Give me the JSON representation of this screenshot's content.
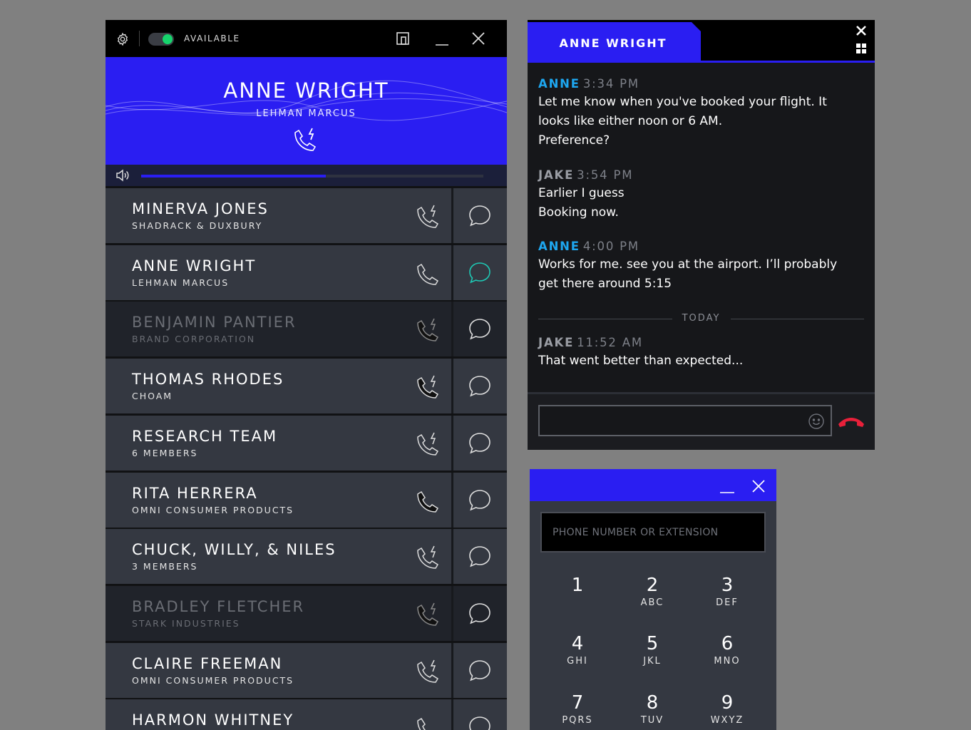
{
  "contacts_window": {
    "status": {
      "label": "AVAILABLE",
      "available": true,
      "indicator_color": "#16d46c"
    },
    "icons": {
      "settings": "gear-icon",
      "popout": "popout-icon",
      "minimize": "minimize-icon",
      "close": "close-icon"
    },
    "active_call": {
      "name": "ANNE WRIGHT",
      "company": "LEHMAN MARCUS",
      "icon": "phone-active-icon",
      "volume_level": 0.54
    },
    "contacts": [
      {
        "name": "MINERVA JONES",
        "subtitle": "SHADRACK & DUXBURY",
        "call_icon": "phone-callback-icon",
        "dimmed": false,
        "chat_active": false
      },
      {
        "name": "ANNE WRIGHT",
        "subtitle": "LEHMAN MARCUS",
        "call_icon": "phone-icon",
        "dimmed": false,
        "chat_active": true
      },
      {
        "name": "BENJAMIN PANTIER",
        "subtitle": "BRAND CORPORATION",
        "call_icon": "phone-busy-icon",
        "dimmed": true,
        "chat_active": false
      },
      {
        "name": "THOMAS RHODES",
        "subtitle": "CHOAM",
        "call_icon": "phone-busy-icon",
        "dimmed": false,
        "chat_active": false
      },
      {
        "name": "RESEARCH TEAM",
        "subtitle": "6 MEMBERS",
        "call_icon": "phone-callback-icon",
        "dimmed": false,
        "chat_active": false
      },
      {
        "name": "RITA HERRERA",
        "subtitle": "OMNI CONSUMER PRODUCTS",
        "call_icon": "phone-filled-icon",
        "dimmed": false,
        "chat_active": false
      },
      {
        "name": "CHUCK, WILLY, & NILES",
        "subtitle": "3 MEMBERS",
        "call_icon": "phone-callback-icon",
        "dimmed": false,
        "chat_active": false
      },
      {
        "name": "BRADLEY FLETCHER",
        "subtitle": "STARK INDUSTRIES",
        "call_icon": "phone-busy-icon",
        "dimmed": true,
        "chat_active": false
      },
      {
        "name": "CLAIRE FREEMAN",
        "subtitle": "OMNI CONSUMER PRODUCTS",
        "call_icon": "phone-callback-icon",
        "dimmed": false,
        "chat_active": false
      },
      {
        "name": "HARMON WHITNEY",
        "subtitle": "",
        "call_icon": "phone-icon",
        "dimmed": false,
        "chat_active": false
      }
    ]
  },
  "chat_window": {
    "tab_title": "ANNE WRIGHT",
    "messages": [
      {
        "sender": "ANNE",
        "time": "3:34 PM",
        "lines": [
          "Let me know when you've booked your flight. It",
          "looks like either noon or 6 AM.",
          "Preference?"
        ]
      },
      {
        "sender": "JAKE",
        "time": "3:54 PM",
        "lines": [
          "Earlier I guess",
          "Booking now."
        ]
      },
      {
        "sender": "ANNE",
        "time": "4:00 PM",
        "lines": [
          "Works for me. see you at the airport. I’ll probably",
          "get there around 5:15"
        ]
      },
      {
        "sender": "JAKE",
        "time": "11:52 AM",
        "lines": [
          "That went better than expected..."
        ]
      }
    ],
    "separator": "TODAY",
    "input_value": "",
    "colors": {
      "anne": "#1ea7f0",
      "jake": "#9a9da4",
      "hangup": "#e8203a"
    }
  },
  "dialer_window": {
    "placeholder": "PHONE NUMBER OR EXTENSION",
    "keys": [
      {
        "digit": "1",
        "letters": ""
      },
      {
        "digit": "2",
        "letters": "ABC"
      },
      {
        "digit": "3",
        "letters": "DEF"
      },
      {
        "digit": "4",
        "letters": "GHI"
      },
      {
        "digit": "5",
        "letters": "JKL"
      },
      {
        "digit": "6",
        "letters": "MNO"
      },
      {
        "digit": "7",
        "letters": "PQRS"
      },
      {
        "digit": "8",
        "letters": "TUV"
      },
      {
        "digit": "9",
        "letters": "WXYZ"
      }
    ]
  },
  "theme": {
    "accent": "#2a1ef2",
    "chat_active": "#1ec8b4"
  }
}
